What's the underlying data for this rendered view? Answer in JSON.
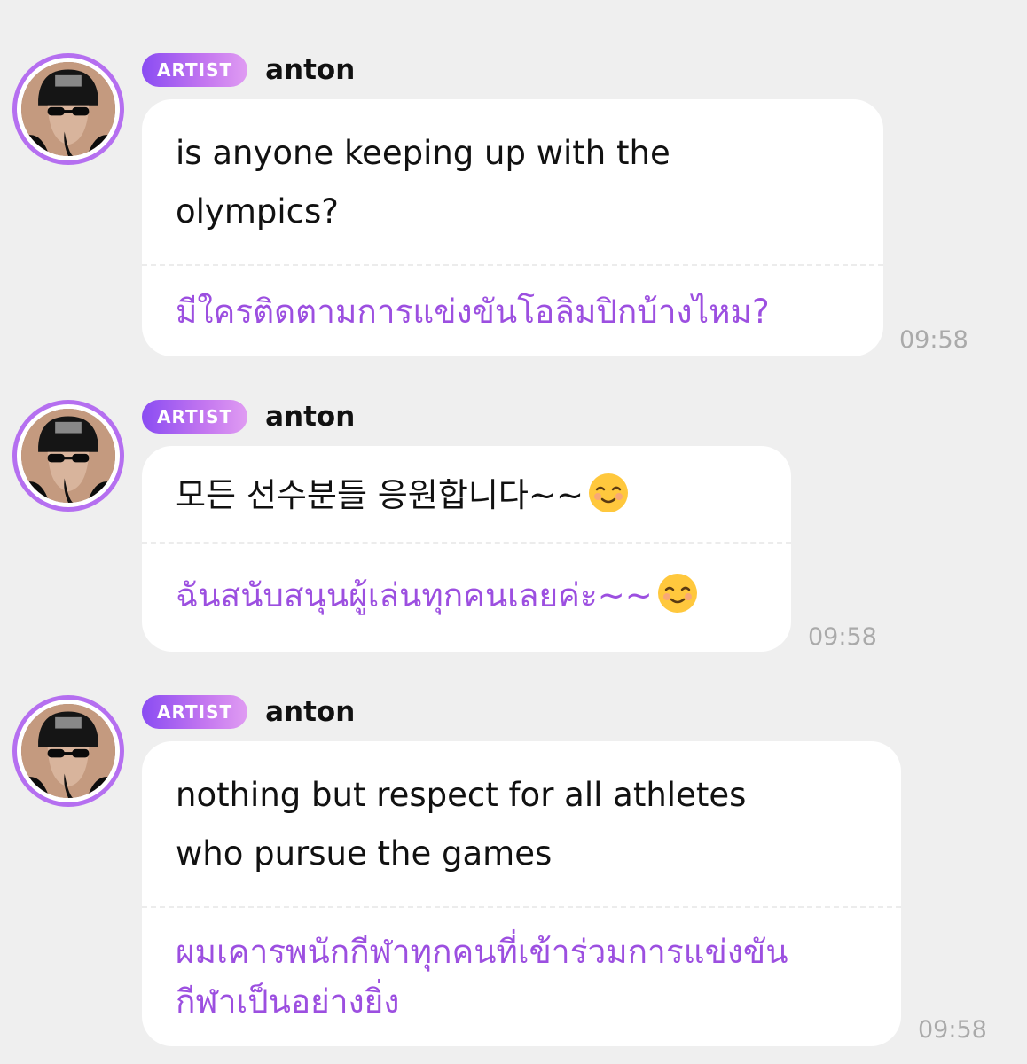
{
  "messages": [
    {
      "badge": "ARTIST",
      "author": "anton",
      "text": "is anyone keeping up with the\nolympics?",
      "translation": "มีใครติดตามการแข่งขันโอลิมปิกบ้างไหม?",
      "time": "09:58",
      "emoji": ""
    },
    {
      "badge": "ARTIST",
      "author": "anton",
      "text": "모든 선수분들 응원합니다~~",
      "translation": "ฉันสนับสนุนผู้เล่นทุกคนเลยค่ะ~~",
      "time": "09:58",
      "emoji": "smiling-face-icon"
    },
    {
      "badge": "ARTIST",
      "author": "anton",
      "text": "nothing but respect for all athletes\nwho pursue the games",
      "translation": "ผมเคารพนักกีฬาทุกคนที่เข้าร่วมการแข่งขัน\nกีฬาเป็นอย่างยิ่ง",
      "time": "09:58",
      "emoji": ""
    }
  ],
  "colors": {
    "background": "#efefef",
    "bubble": "#ffffff",
    "translation_text": "#9c4fe0",
    "badge_start": "#8a4cf2",
    "badge_end": "#e09cf2",
    "avatar_ring": "#b56ff0",
    "timestamp": "#aaaaaa"
  }
}
